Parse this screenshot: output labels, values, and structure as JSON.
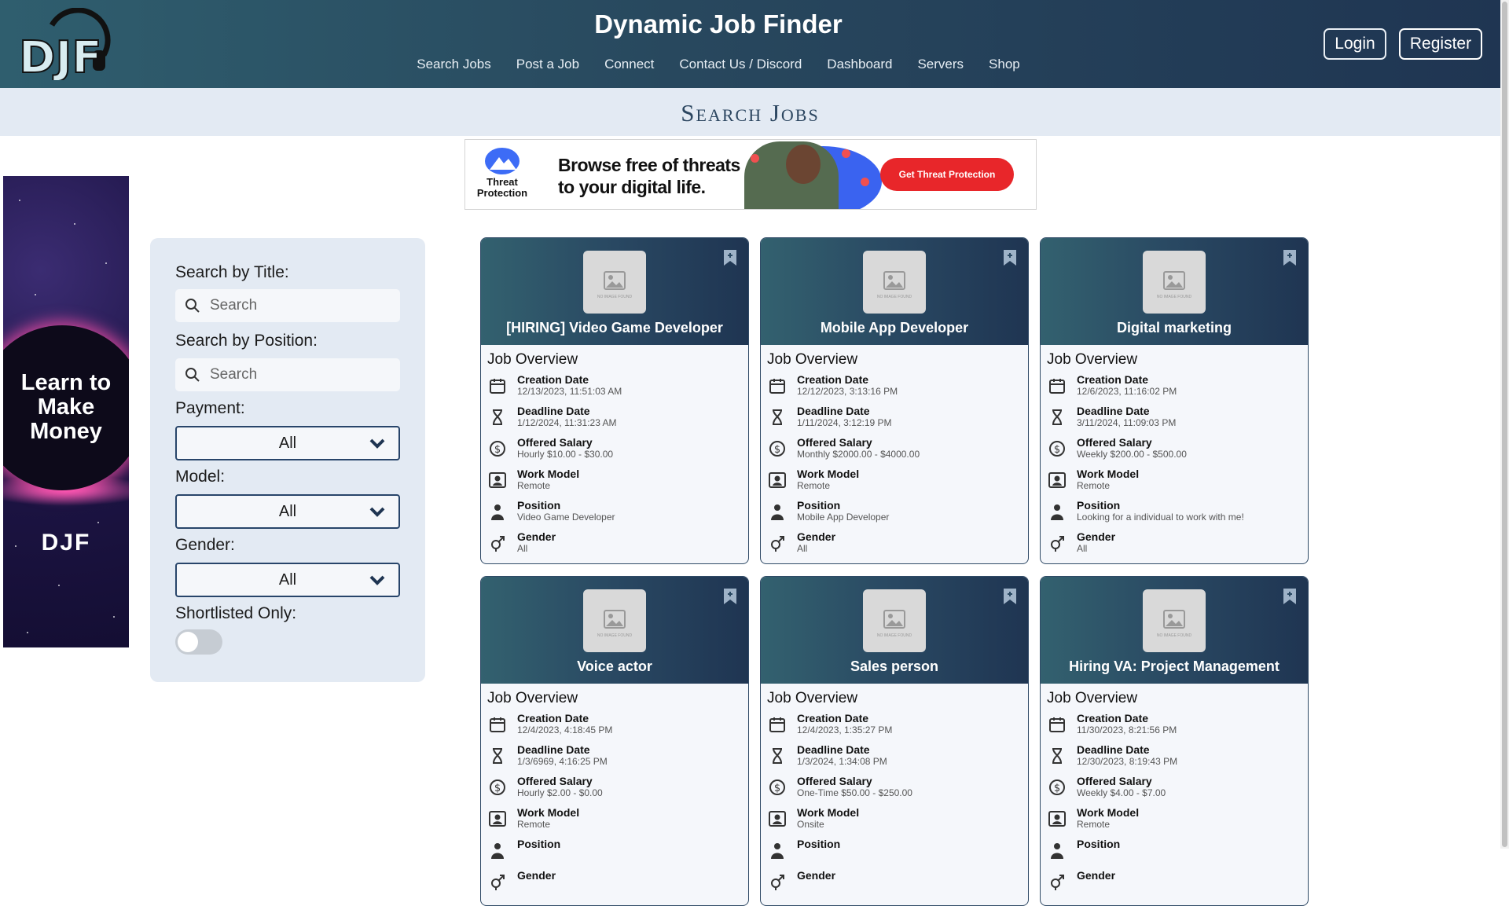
{
  "header": {
    "logo_text": "DJF",
    "title": "Dynamic Job Finder",
    "nav": [
      "Search Jobs",
      "Post a Job",
      "Connect",
      "Contact Us / Discord",
      "Dashboard",
      "Servers",
      "Shop"
    ],
    "login_label": "Login",
    "register_label": "Register"
  },
  "page_heading": "Search Jobs",
  "top_ad": {
    "brand": "Threat Protection",
    "headline_line1": "Browse free of threats",
    "headline_line2": "to your digital life.",
    "cta": "Get Threat Protection"
  },
  "side_ad": {
    "copy_line1": "Learn to",
    "copy_line2": "Make",
    "copy_line3": "Money",
    "mark": "DJF"
  },
  "filters": {
    "title_label": "Search by Title:",
    "title_placeholder": "Search",
    "position_label": "Search by Position:",
    "position_placeholder": "Search",
    "payment_label": "Payment:",
    "payment_value": "All",
    "model_label": "Model:",
    "model_value": "All",
    "gender_label": "Gender:",
    "gender_value": "All",
    "shortlisted_label": "Shortlisted Only:",
    "shortlisted_on": false
  },
  "card_labels": {
    "overview": "Job Overview",
    "creation": "Creation Date",
    "deadline": "Deadline Date",
    "salary": "Offered Salary",
    "model": "Work Model",
    "position": "Position",
    "gender": "Gender",
    "no_image": "NO IMAGE FOUND"
  },
  "jobs": [
    {
      "title": "[HIRING] Video Game Developer",
      "creation": "12/13/2023, 11:51:03 AM",
      "deadline": "1/12/2024, 11:31:23 AM",
      "salary": "Hourly $10.00 - $30.00",
      "model": "Remote",
      "position": "Video Game Developer",
      "gender": "All"
    },
    {
      "title": "Mobile App Developer",
      "creation": "12/12/2023, 3:13:16 PM",
      "deadline": "1/11/2024, 3:12:19 PM",
      "salary": "Monthly $2000.00 - $4000.00",
      "model": "Remote",
      "position": "Mobile App Developer",
      "gender": "All"
    },
    {
      "title": "Digital marketing",
      "creation": "12/6/2023, 11:16:02 PM",
      "deadline": "3/11/2024, 11:09:03 PM",
      "salary": "Weekly $200.00 - $500.00",
      "model": "Remote",
      "position": "Looking for a individual to work with me!",
      "gender": "All"
    },
    {
      "title": "Voice actor",
      "creation": "12/4/2023, 4:18:45 PM",
      "deadline": "1/3/6969, 4:16:25 PM",
      "salary": "Hourly $2.00 - $0.00",
      "model": "Remote",
      "position": "",
      "gender": ""
    },
    {
      "title": "Sales person",
      "creation": "12/4/2023, 1:35:27 PM",
      "deadline": "1/3/2024, 1:34:08 PM",
      "salary": "One-Time $50.00 - $250.00",
      "model": "Onsite",
      "position": "",
      "gender": ""
    },
    {
      "title": "Hiring VA: Project Management",
      "creation": "11/30/2023, 8:21:56 PM",
      "deadline": "12/30/2023, 8:19:43 PM",
      "salary": "Weekly $4.00 - $7.00",
      "model": "Remote",
      "position": "",
      "gender": ""
    }
  ]
}
